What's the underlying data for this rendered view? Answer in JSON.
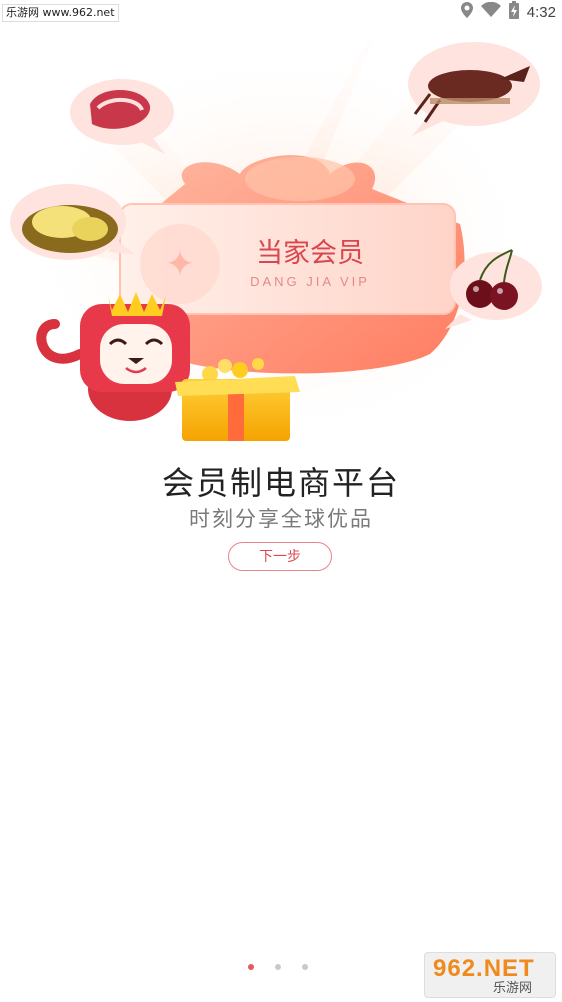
{
  "status_bar": {
    "watermark_text": "乐游网 www.962.net",
    "time": "4:32",
    "icons": [
      "location-icon",
      "wifi-icon",
      "battery-charging-icon"
    ]
  },
  "hero": {
    "card_title": "当家会员",
    "card_subtitle": "DANG JIA VIP",
    "fruit_bubbles": [
      "meat",
      "durian",
      "lobster",
      "cherries"
    ]
  },
  "onboarding": {
    "headline": "会员制电商平台",
    "subheadline": "时刻分享全球优品",
    "next_button_label": "下一步",
    "page_count": 3,
    "current_page": 1
  },
  "watermark_bottom": {
    "brand": "962.NET",
    "sub": "乐游网"
  },
  "colors": {
    "accent": "#e8565e",
    "button_border": "#e8858a",
    "dot_inactive": "#c9c9c9",
    "headline": "#222222",
    "subheadline": "#7a7a7a"
  }
}
